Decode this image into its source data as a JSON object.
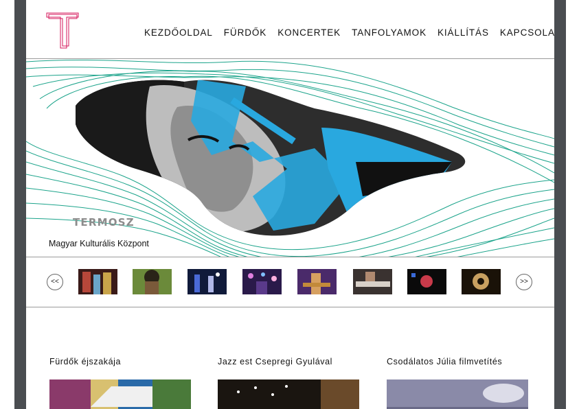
{
  "nav": {
    "items": [
      {
        "label": "KEZDŐOLDAL"
      },
      {
        "label": "FÜRDŐK"
      },
      {
        "label": "KONCERTEK"
      },
      {
        "label": "TANFOLYAMOK"
      },
      {
        "label": "KIÁLLÍTÁS"
      },
      {
        "label": "KAPCSOLAT"
      }
    ]
  },
  "hero": {
    "title": "TERMOSZ",
    "subtitle": "Magyar Kulturális Központ"
  },
  "strip": {
    "prev_label": "<<",
    "next_label": ">>"
  },
  "cards": [
    {
      "title": "Fürdők éjszakája"
    },
    {
      "title": "Jazz est Csepregi Gyulával"
    },
    {
      "title": "Csodálatos Júlia filmvetítés"
    }
  ],
  "colors": {
    "sidebar": "#4a4d51",
    "contour": "#1aa38a",
    "accent_blue": "#29a8df",
    "logo_red": "#d4145a"
  }
}
